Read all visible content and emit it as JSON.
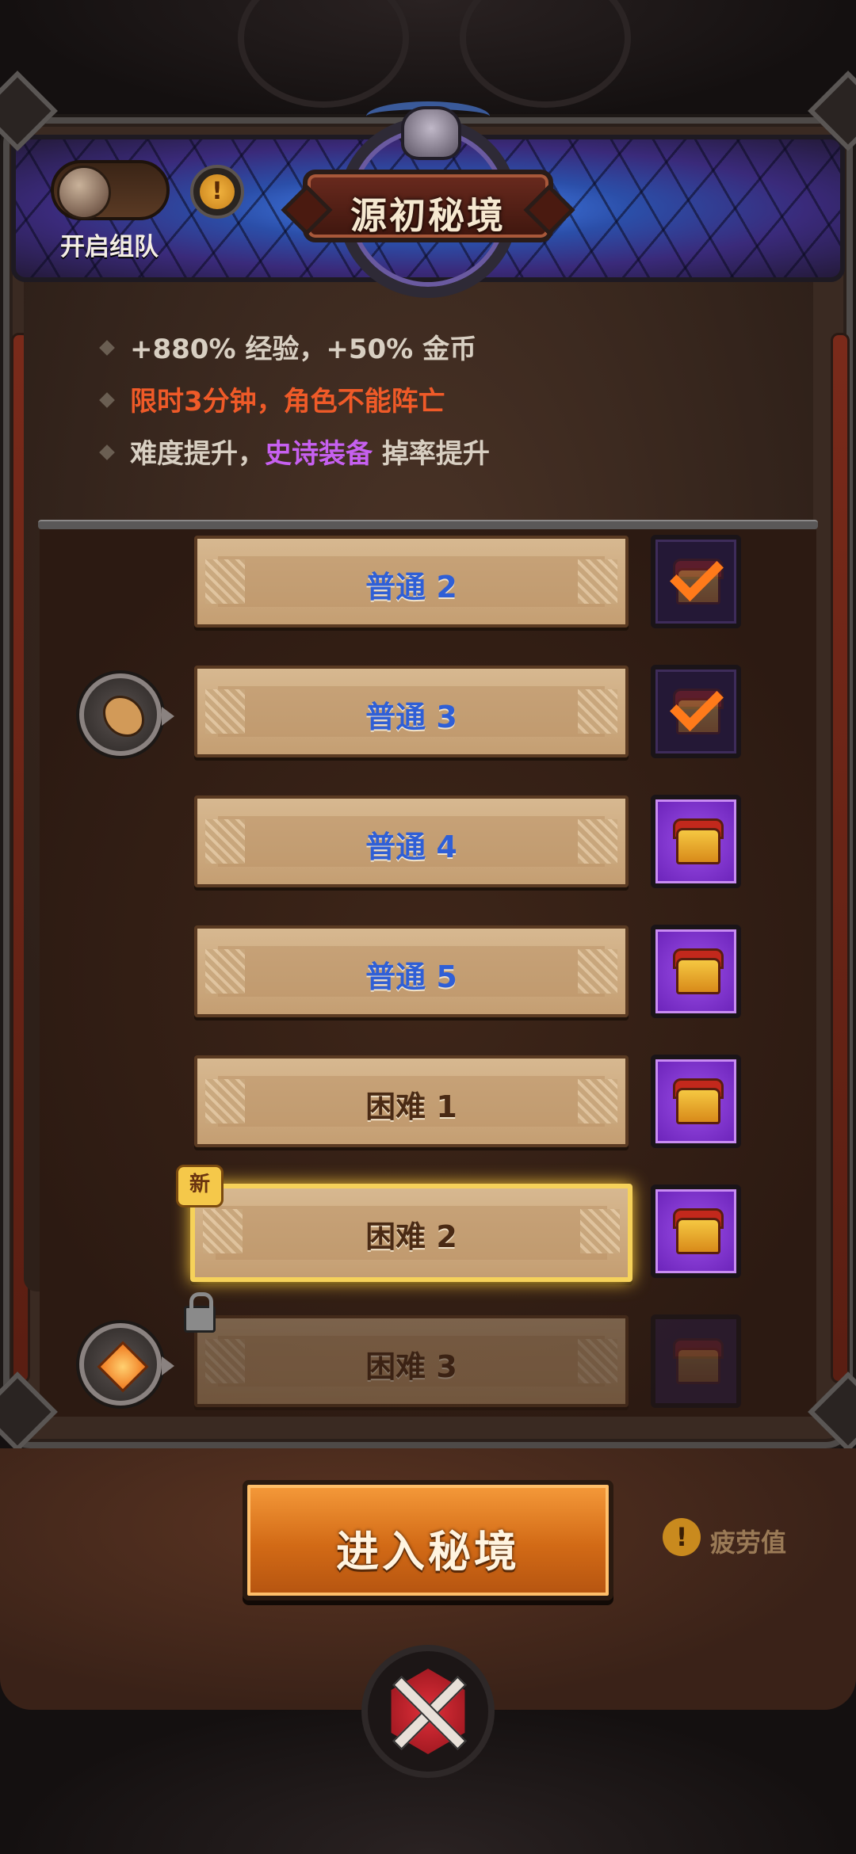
{
  "header": {
    "title": "源初秘境",
    "team_toggle_label": "开启组队",
    "team_toggle_on": false,
    "info_icon": "exclamation-circle-icon"
  },
  "bullets": [
    {
      "text": "+880% 经验，+50% 金币",
      "color": "#d8cfc2"
    },
    {
      "text": "限时3分钟，角色不能阵亡",
      "color": "#ef5a28"
    },
    {
      "parts": [
        {
          "text": "难度提升，",
          "color": "#d8cfc2"
        },
        {
          "text": "史诗装备",
          "color": "#c660f0"
        },
        {
          "text": " 掉率提升",
          "color": "#d8cfc2"
        }
      ]
    }
  ],
  "levels": [
    {
      "label": "普通 2",
      "tier": "normal",
      "chest": "completed",
      "state": "cleared"
    },
    {
      "label": "普通 3",
      "tier": "normal",
      "chest": "completed",
      "state": "cleared",
      "marker": "wolf-icon"
    },
    {
      "label": "普通 4",
      "tier": "normal",
      "chest": "available",
      "state": "open"
    },
    {
      "label": "普通 5",
      "tier": "normal",
      "chest": "available",
      "state": "open"
    },
    {
      "label": "困难 1",
      "tier": "hard",
      "chest": "available",
      "state": "open"
    },
    {
      "label": "困难 2",
      "tier": "hard",
      "chest": "available",
      "state": "selected",
      "badge": "新"
    },
    {
      "label": "困难 3",
      "tier": "hard",
      "chest": "locked",
      "state": "locked",
      "marker": "gem-icon"
    }
  ],
  "footer": {
    "enter_button": "进入秘境",
    "fatigue_label": "疲劳值",
    "close_icon": "crossed-swords-close-icon"
  },
  "colors": {
    "normal_label": "#2f5fd6",
    "hard_label": "#4a2a14",
    "highlight": "#f6d25a",
    "enter_button": "#d26a16",
    "chest_purple": "#7a2ec8"
  }
}
